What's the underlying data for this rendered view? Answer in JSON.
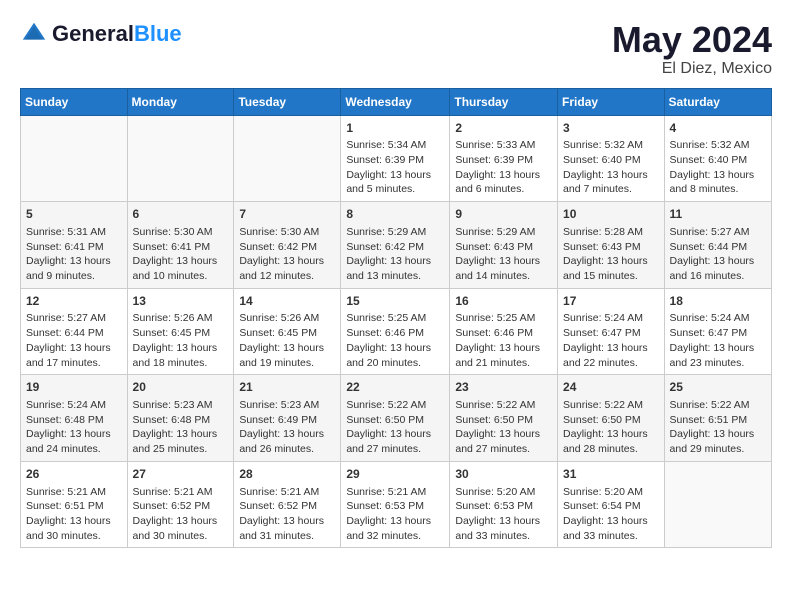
{
  "header": {
    "logo_line1": "General",
    "logo_line2": "Blue",
    "title": "May 2024",
    "subtitle": "El Diez, Mexico"
  },
  "calendar": {
    "days_of_week": [
      "Sunday",
      "Monday",
      "Tuesday",
      "Wednesday",
      "Thursday",
      "Friday",
      "Saturday"
    ],
    "weeks": [
      [
        {
          "day": "",
          "content": ""
        },
        {
          "day": "",
          "content": ""
        },
        {
          "day": "",
          "content": ""
        },
        {
          "day": "1",
          "content": "Sunrise: 5:34 AM\nSunset: 6:39 PM\nDaylight: 13 hours\nand 5 minutes."
        },
        {
          "day": "2",
          "content": "Sunrise: 5:33 AM\nSunset: 6:39 PM\nDaylight: 13 hours\nand 6 minutes."
        },
        {
          "day": "3",
          "content": "Sunrise: 5:32 AM\nSunset: 6:40 PM\nDaylight: 13 hours\nand 7 minutes."
        },
        {
          "day": "4",
          "content": "Sunrise: 5:32 AM\nSunset: 6:40 PM\nDaylight: 13 hours\nand 8 minutes."
        }
      ],
      [
        {
          "day": "5",
          "content": "Sunrise: 5:31 AM\nSunset: 6:41 PM\nDaylight: 13 hours\nand 9 minutes."
        },
        {
          "day": "6",
          "content": "Sunrise: 5:30 AM\nSunset: 6:41 PM\nDaylight: 13 hours\nand 10 minutes."
        },
        {
          "day": "7",
          "content": "Sunrise: 5:30 AM\nSunset: 6:42 PM\nDaylight: 13 hours\nand 12 minutes."
        },
        {
          "day": "8",
          "content": "Sunrise: 5:29 AM\nSunset: 6:42 PM\nDaylight: 13 hours\nand 13 minutes."
        },
        {
          "day": "9",
          "content": "Sunrise: 5:29 AM\nSunset: 6:43 PM\nDaylight: 13 hours\nand 14 minutes."
        },
        {
          "day": "10",
          "content": "Sunrise: 5:28 AM\nSunset: 6:43 PM\nDaylight: 13 hours\nand 15 minutes."
        },
        {
          "day": "11",
          "content": "Sunrise: 5:27 AM\nSunset: 6:44 PM\nDaylight: 13 hours\nand 16 minutes."
        }
      ],
      [
        {
          "day": "12",
          "content": "Sunrise: 5:27 AM\nSunset: 6:44 PM\nDaylight: 13 hours\nand 17 minutes."
        },
        {
          "day": "13",
          "content": "Sunrise: 5:26 AM\nSunset: 6:45 PM\nDaylight: 13 hours\nand 18 minutes."
        },
        {
          "day": "14",
          "content": "Sunrise: 5:26 AM\nSunset: 6:45 PM\nDaylight: 13 hours\nand 19 minutes."
        },
        {
          "day": "15",
          "content": "Sunrise: 5:25 AM\nSunset: 6:46 PM\nDaylight: 13 hours\nand 20 minutes."
        },
        {
          "day": "16",
          "content": "Sunrise: 5:25 AM\nSunset: 6:46 PM\nDaylight: 13 hours\nand 21 minutes."
        },
        {
          "day": "17",
          "content": "Sunrise: 5:24 AM\nSunset: 6:47 PM\nDaylight: 13 hours\nand 22 minutes."
        },
        {
          "day": "18",
          "content": "Sunrise: 5:24 AM\nSunset: 6:47 PM\nDaylight: 13 hours\nand 23 minutes."
        }
      ],
      [
        {
          "day": "19",
          "content": "Sunrise: 5:24 AM\nSunset: 6:48 PM\nDaylight: 13 hours\nand 24 minutes."
        },
        {
          "day": "20",
          "content": "Sunrise: 5:23 AM\nSunset: 6:48 PM\nDaylight: 13 hours\nand 25 minutes."
        },
        {
          "day": "21",
          "content": "Sunrise: 5:23 AM\nSunset: 6:49 PM\nDaylight: 13 hours\nand 26 minutes."
        },
        {
          "day": "22",
          "content": "Sunrise: 5:22 AM\nSunset: 6:50 PM\nDaylight: 13 hours\nand 27 minutes."
        },
        {
          "day": "23",
          "content": "Sunrise: 5:22 AM\nSunset: 6:50 PM\nDaylight: 13 hours\nand 27 minutes."
        },
        {
          "day": "24",
          "content": "Sunrise: 5:22 AM\nSunset: 6:50 PM\nDaylight: 13 hours\nand 28 minutes."
        },
        {
          "day": "25",
          "content": "Sunrise: 5:22 AM\nSunset: 6:51 PM\nDaylight: 13 hours\nand 29 minutes."
        }
      ],
      [
        {
          "day": "26",
          "content": "Sunrise: 5:21 AM\nSunset: 6:51 PM\nDaylight: 13 hours\nand 30 minutes."
        },
        {
          "day": "27",
          "content": "Sunrise: 5:21 AM\nSunset: 6:52 PM\nDaylight: 13 hours\nand 30 minutes."
        },
        {
          "day": "28",
          "content": "Sunrise: 5:21 AM\nSunset: 6:52 PM\nDaylight: 13 hours\nand 31 minutes."
        },
        {
          "day": "29",
          "content": "Sunrise: 5:21 AM\nSunset: 6:53 PM\nDaylight: 13 hours\nand 32 minutes."
        },
        {
          "day": "30",
          "content": "Sunrise: 5:20 AM\nSunset: 6:53 PM\nDaylight: 13 hours\nand 33 minutes."
        },
        {
          "day": "31",
          "content": "Sunrise: 5:20 AM\nSunset: 6:54 PM\nDaylight: 13 hours\nand 33 minutes."
        },
        {
          "day": "",
          "content": ""
        }
      ]
    ]
  }
}
